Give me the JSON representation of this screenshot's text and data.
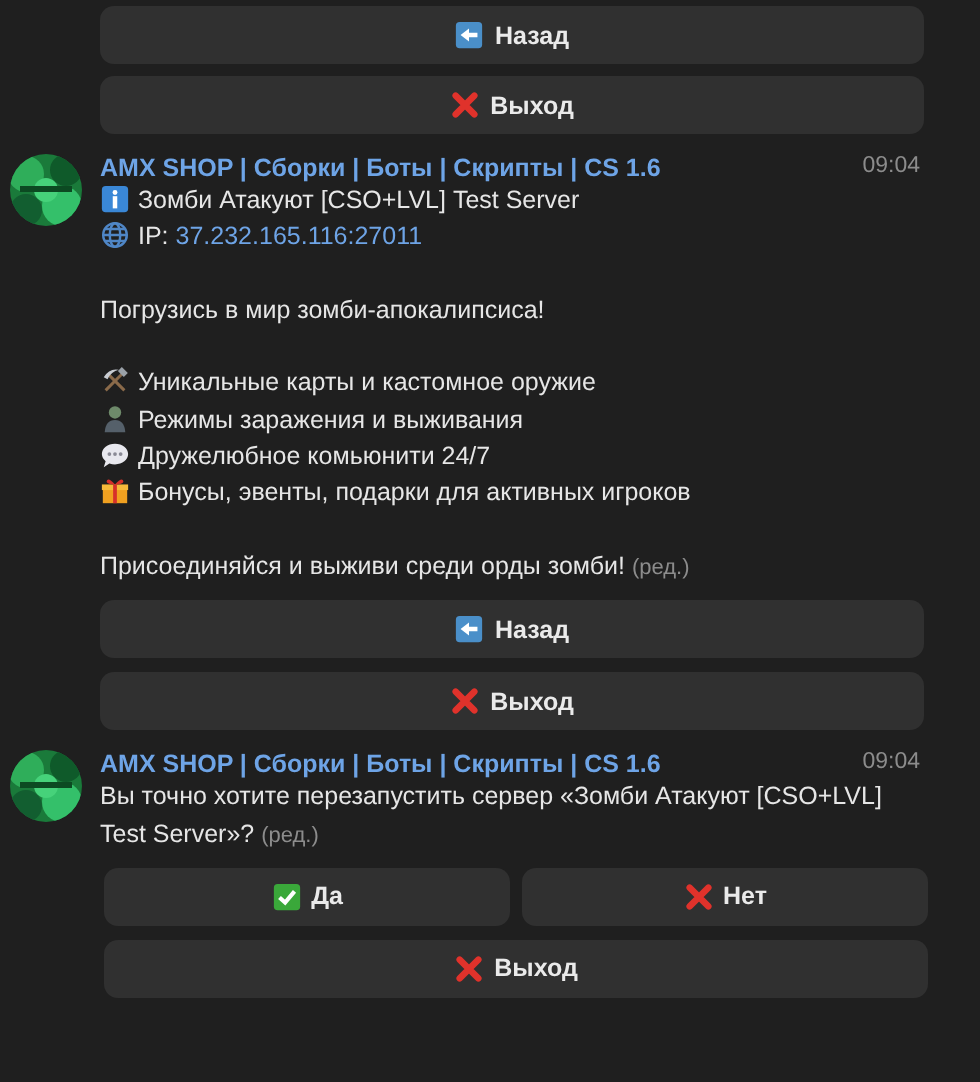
{
  "top_keyboard": [
    [
      {
        "kind": "back",
        "label": "Назад"
      }
    ],
    [
      {
        "kind": "cross",
        "label": "Выход"
      }
    ]
  ],
  "messages": [
    {
      "author": "AMX SHOP | Сборки | Боты | Скрипты | CS 1.6",
      "time": "09:04",
      "edited": "(ред.)",
      "blocks": [
        [
          {
            "kind": "info",
            "text": "Зомби Атакуют [CSO+LVL] Test Server"
          },
          {
            "kind": "globe",
            "text": "IP:",
            "link": "37.232.165.116:27011"
          }
        ],
        [
          {
            "text": "Погрузись в мир зомби-апокалипсиса!"
          }
        ],
        [
          {
            "kind": "tools",
            "text": "Уникальные карты и кастомное оружие"
          },
          {
            "kind": "zombie",
            "text": "Режимы заражения и выживания"
          },
          {
            "kind": "speech",
            "text": "Дружелюбное комьюнити 24/7"
          },
          {
            "kind": "gift",
            "text": "Бонусы, эвенты, подарки для активных игроков"
          }
        ],
        [
          {
            "text": "Присоединяйся и выживи среди орды зомби!"
          }
        ]
      ],
      "keyboard": [
        [
          {
            "kind": "back",
            "label": "Назад"
          }
        ],
        [
          {
            "kind": "cross",
            "label": "Выход"
          }
        ]
      ]
    },
    {
      "author": "AMX SHOP | Сборки | Боты | Скрипты | CS 1.6",
      "time": "09:04",
      "edited": "(ред.)",
      "blocks": [
        [
          {
            "text": "Вы точно хотите перезапустить сервер «Зомби Атакуют [CSO+LVL] Test Server»?"
          }
        ]
      ],
      "keyboard": [
        [
          {
            "kind": "check",
            "label": "Да"
          },
          {
            "kind": "cross",
            "label": "Нет"
          }
        ],
        [
          {
            "kind": "cross",
            "label": "Выход"
          }
        ]
      ]
    }
  ]
}
